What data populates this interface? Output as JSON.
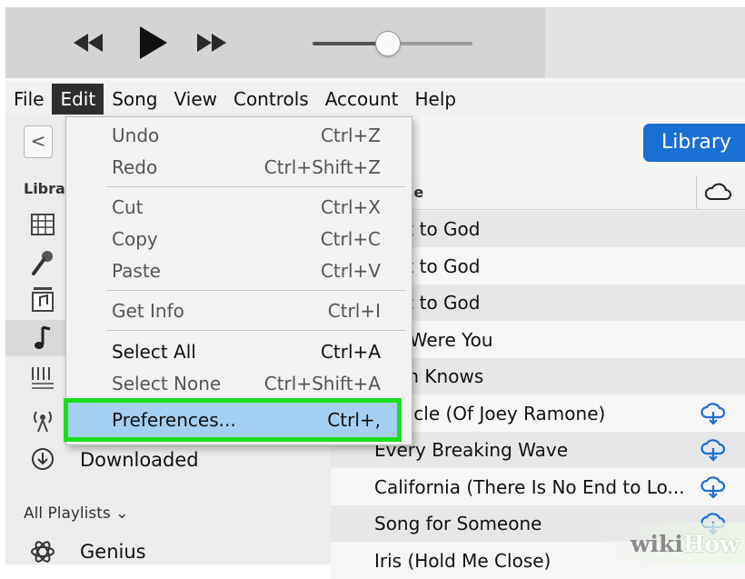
{
  "menubar": [
    "File",
    "Edit",
    "Song",
    "View",
    "Controls",
    "Account",
    "Help"
  ],
  "edit_menu": {
    "items": [
      {
        "label": "Undo",
        "shortcut": "Ctrl+Z"
      },
      {
        "label": "Redo",
        "shortcut": "Ctrl+Shift+Z"
      },
      {
        "label": "Cut",
        "shortcut": "Ctrl+X"
      },
      {
        "label": "Copy",
        "shortcut": "Ctrl+C"
      },
      {
        "label": "Paste",
        "shortcut": "Ctrl+V"
      },
      {
        "label": "Get Info",
        "shortcut": "Ctrl+I"
      },
      {
        "label": "Select All",
        "shortcut": "Ctrl+A"
      },
      {
        "label": "Select None",
        "shortcut": "Ctrl+Shift+A"
      },
      {
        "label": "Preferences...",
        "shortcut": "Ctrl+,"
      }
    ],
    "highlighted_item": "Preferences..."
  },
  "sidebar": {
    "back_glyph": "<",
    "library_heading": "Libra",
    "downloaded_label": "Downloaded",
    "all_playlists_label": "All Playlists ⌄",
    "genius_label": "Genius"
  },
  "content": {
    "library_button": "Library",
    "name_column_partial": "ne",
    "songs": [
      {
        "title": "nest to God",
        "cloud": false
      },
      {
        "title": "nest to God",
        "cloud": false
      },
      {
        "title": "nest to God",
        "cloud": false
      },
      {
        "title": "ere Were You",
        "cloud": false
      },
      {
        "title": "aven Knows",
        "cloud": false
      },
      {
        "title": "Miracle (Of Joey Ramone)",
        "cloud": true
      },
      {
        "title": "Every Breaking Wave",
        "cloud": true
      },
      {
        "title": "California (There Is No End to Lo...",
        "cloud": true
      },
      {
        "title": "Song for Someone",
        "cloud": true
      },
      {
        "title": "Iris (Hold Me Close)",
        "cloud": false
      }
    ]
  },
  "player": {
    "volume_level": 0.47
  },
  "watermark": {
    "wiki": "wiki",
    "how": "How"
  },
  "colors": {
    "accent": "#1a6fd3",
    "highlight_outline": "#16e01c",
    "highlight_fill": "#a5cff0",
    "cloud": "#1a6fd3"
  }
}
